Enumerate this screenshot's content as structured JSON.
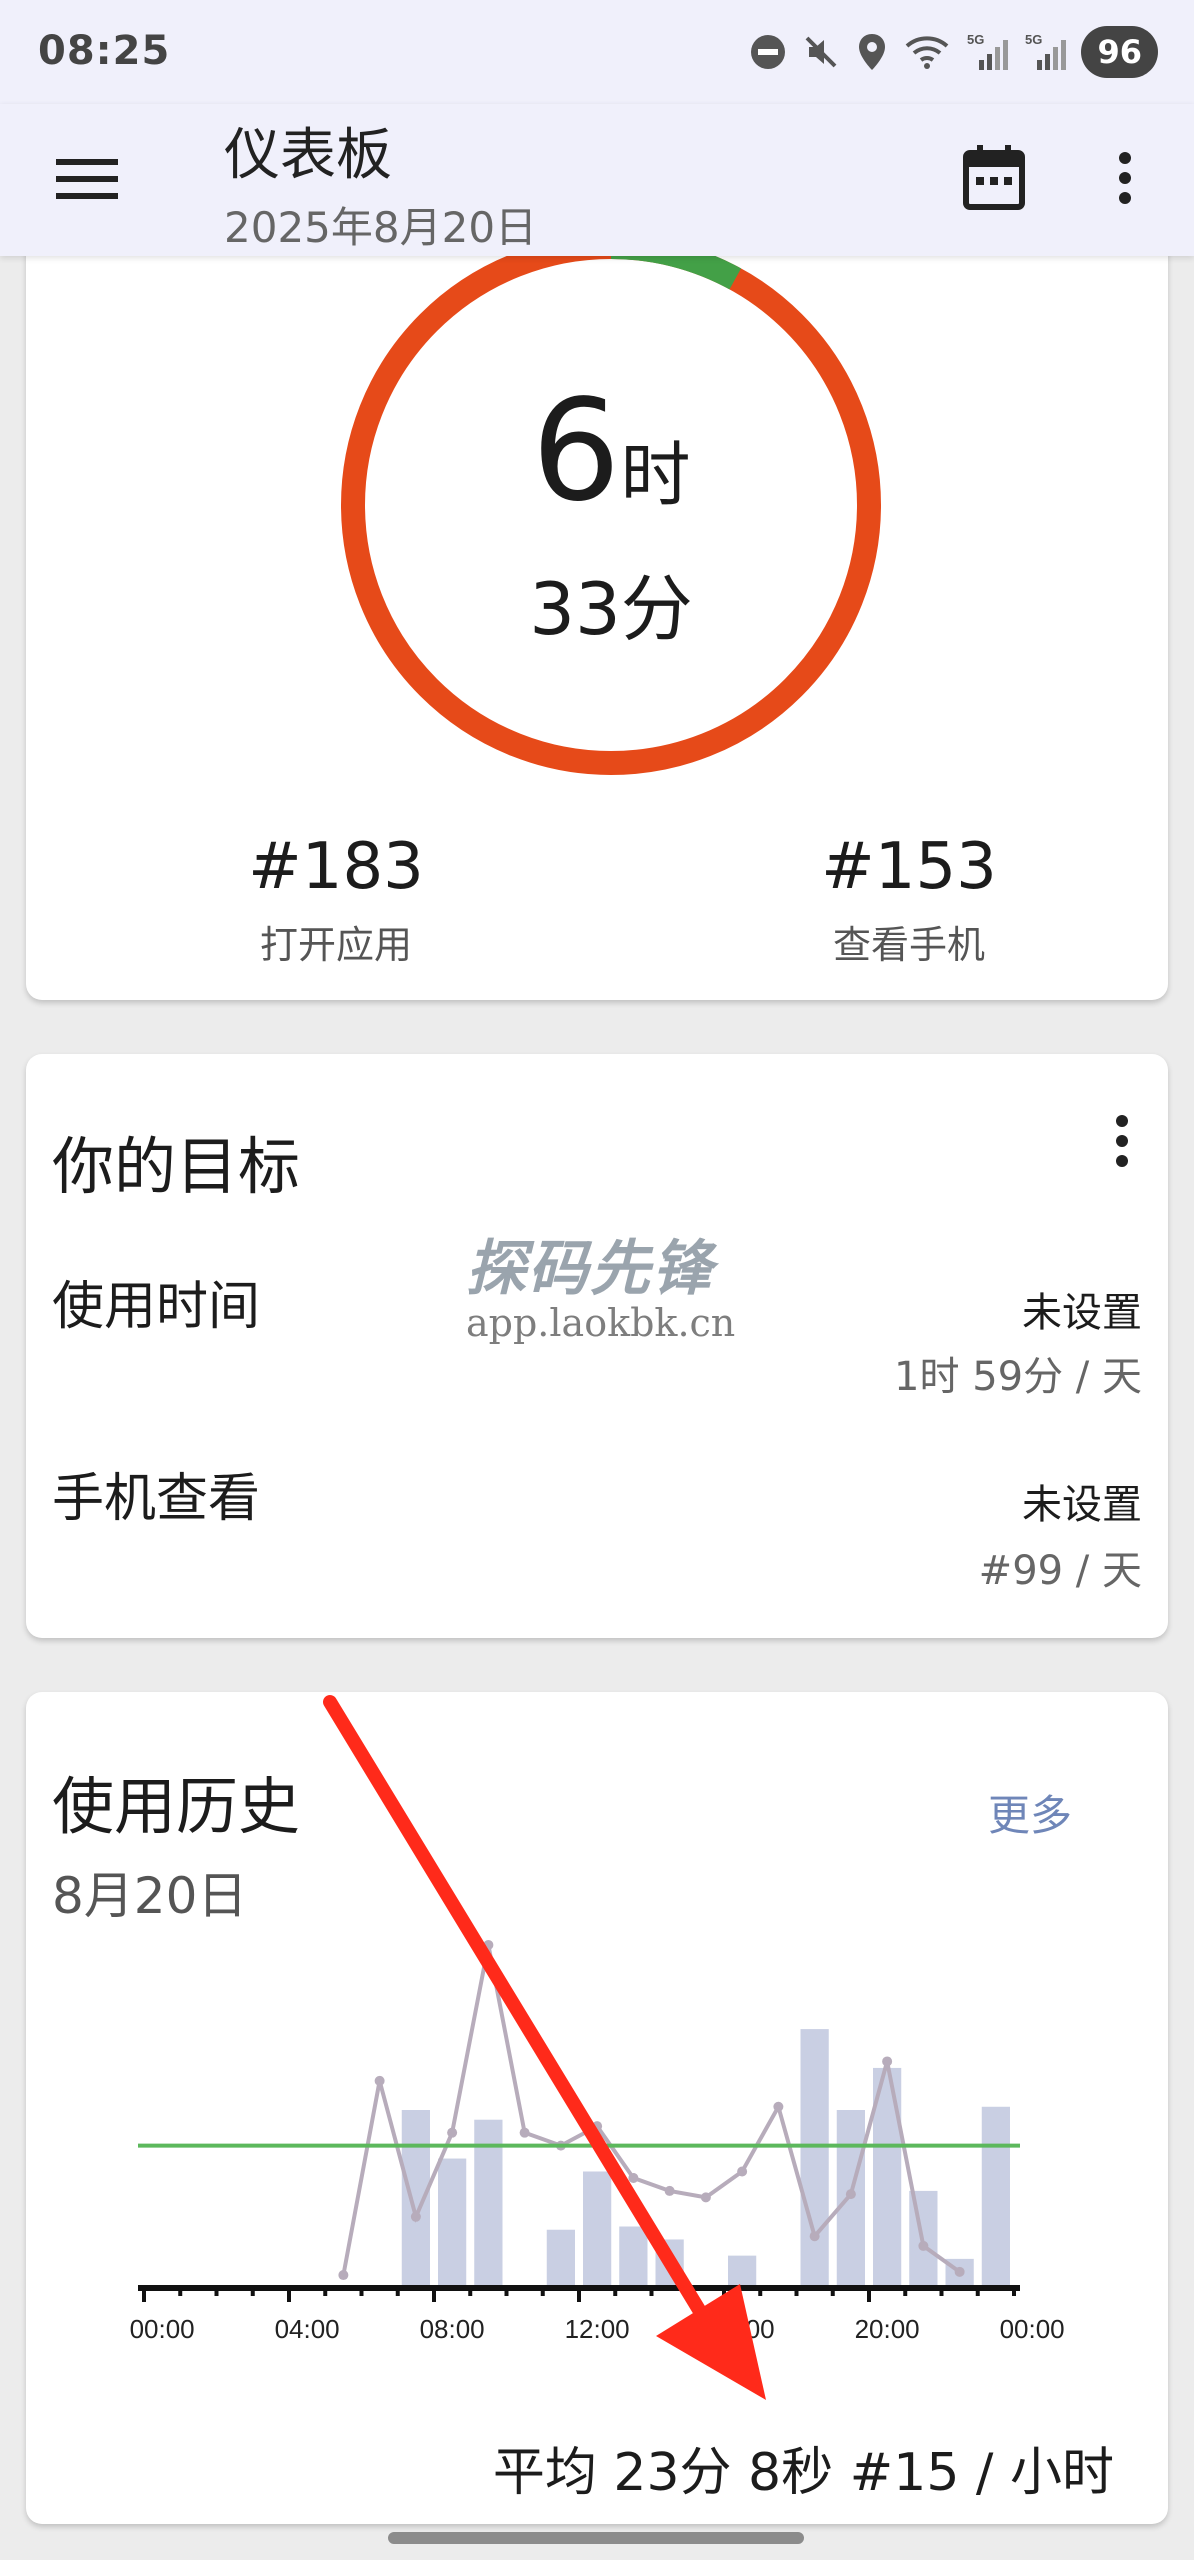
{
  "status_bar": {
    "time": "08:25",
    "battery": "96",
    "icons": [
      "dnd-icon",
      "mute-icon",
      "location-icon",
      "wifi-icon",
      "signal-5g-icon",
      "signal-5g-icon"
    ],
    "signal_label": "5G"
  },
  "app_bar": {
    "title": "仪表板",
    "date": "2025年8月20日",
    "icons": [
      "menu-icon",
      "calendar-icon",
      "more-vert-icon"
    ]
  },
  "summary": {
    "hours_value": "6",
    "hours_unit": "时",
    "minutes": "33分",
    "ring": {
      "used_fraction": 0.92,
      "remaining_fraction": 0.08,
      "used_color": "#e64a19",
      "remaining_color": "#43a047"
    },
    "apps_opened": {
      "value": "#183",
      "label": "打开应用"
    },
    "phone_checks": {
      "value": "#153",
      "label": "查看手机"
    }
  },
  "goals": {
    "title": "你的目标",
    "items": [
      {
        "label": "使用时间",
        "status": "未设置",
        "target": "1时 59分 / 天"
      },
      {
        "label": "手机查看",
        "status": "未设置",
        "target": "#99 / 天"
      }
    ]
  },
  "watermark": {
    "title": "探码先锋",
    "url": "app.laokbk.cn"
  },
  "history": {
    "title": "使用历史",
    "more_label": "更多",
    "date": "8月20日",
    "average": "平均 23分 8秒 #15 / 小时",
    "x_tick_labels": [
      "00:00",
      "04:00",
      "08:00",
      "12:00",
      "16:00",
      "20:00",
      "00:00"
    ]
  },
  "chart_data": {
    "type": "bar",
    "x": [
      0,
      1,
      2,
      3,
      4,
      5,
      6,
      7,
      8,
      9,
      10,
      11,
      12,
      13,
      14,
      15,
      16,
      17,
      18,
      19,
      20,
      21,
      22,
      23
    ],
    "series": [
      {
        "kind": "bar",
        "values": [
          0,
          0,
          0,
          0,
          0,
          0,
          0,
          5.5,
          4,
          5.2,
          0,
          1.8,
          3.6,
          1.9,
          1.5,
          0,
          1,
          0,
          8,
          5.5,
          6.8,
          3,
          0.9,
          5.6
        ]
      },
      {
        "kind": "line",
        "values": [
          null,
          null,
          null,
          null,
          null,
          0.4,
          6.4,
          2.2,
          4.8,
          10.6,
          4.8,
          4.4,
          5,
          3.4,
          3,
          2.8,
          3.6,
          5.6,
          1.6,
          2.9,
          7,
          1.3,
          0.5,
          null
        ]
      },
      {
        "kind": "reference",
        "values": [
          4.4
        ]
      }
    ],
    "ylim": [
      0,
      11
    ],
    "colors": {
      "bar": "#c9cfe3",
      "line": "#b7acbb",
      "reference": "#5cb85c"
    }
  }
}
